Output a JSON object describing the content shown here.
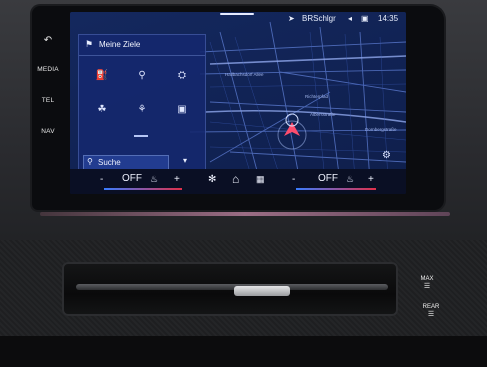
{
  "hardware_buttons": {
    "back_icon": "back-arrow-icon",
    "media": "MEDIA",
    "tel": "TEL",
    "nav": "NAV"
  },
  "status_bar": {
    "network": "BRSchlgr",
    "time": "14:35"
  },
  "favorites_panel": {
    "title": "Meine Ziele",
    "icons": [
      "fuel-icon",
      "parking-icon",
      "picnic-icon",
      "hotel-icon",
      "restaurant-icon",
      "shopping-icon"
    ],
    "search_label": "Suche"
  },
  "map_labels": [
    "Albersstraße",
    "Hallbachsdorf Allee",
    "Richterpfad",
    "Dornbergstraße"
  ],
  "bottom_bar": {
    "left_value": "OFF",
    "right_value": "OFF",
    "minus": "-",
    "plus": "+"
  },
  "console_buttons": {
    "max": "MAX",
    "rear": "REAR"
  },
  "colors": {
    "map_background": "#112355",
    "panel": "#14286e",
    "accent_red": "#e0304a",
    "accent_blue": "#3a7cff"
  }
}
